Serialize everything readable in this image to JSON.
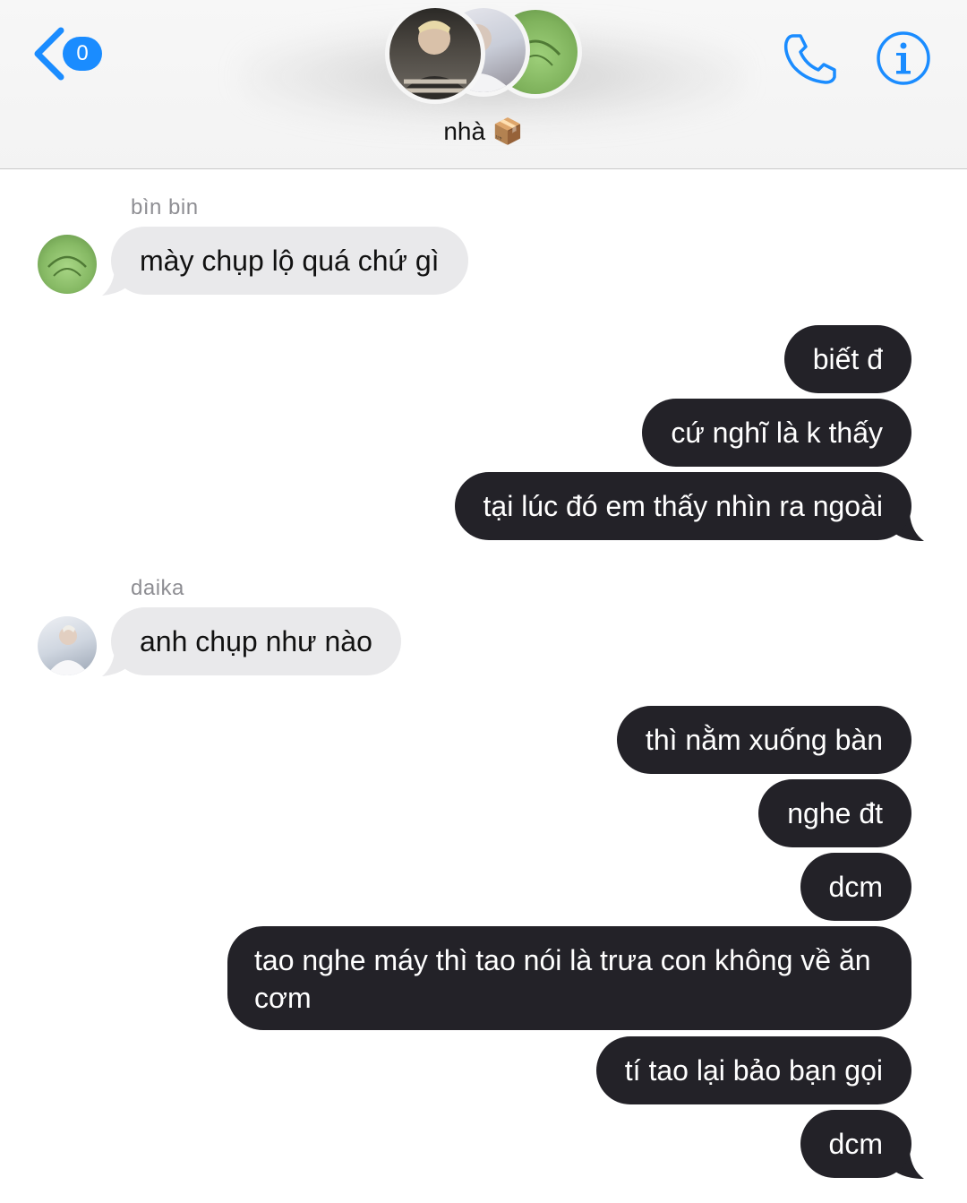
{
  "header": {
    "back_count": "0",
    "group_name": "nhà",
    "group_emoji": "📦",
    "accent_color": "#1a8cff",
    "icons": [
      "chevron-left-icon",
      "phone-icon",
      "info-icon"
    ]
  },
  "messages": [
    {
      "sender": "bìn bin",
      "text": "mày chụp lộ quá chứ gì",
      "direction": "incoming"
    },
    {
      "text": "biết đ",
      "direction": "outgoing"
    },
    {
      "text": "cứ nghĩ là k thấy",
      "direction": "outgoing"
    },
    {
      "text": "tại lúc đó em thấy nhìn ra ngoài",
      "direction": "outgoing"
    },
    {
      "sender": "daika",
      "text": "anh chụp như nào",
      "direction": "incoming"
    },
    {
      "text": "thì nằm xuống bàn",
      "direction": "outgoing"
    },
    {
      "text": "nghe đt",
      "direction": "outgoing"
    },
    {
      "text": "dcm",
      "direction": "outgoing"
    },
    {
      "text": "tao nghe máy thì tao nói là trưa con không về ăn cơm",
      "direction": "outgoing"
    },
    {
      "text": "tí tao lại bảo bạn gọi",
      "direction": "outgoing"
    },
    {
      "text": "dcm",
      "direction": "outgoing"
    }
  ]
}
